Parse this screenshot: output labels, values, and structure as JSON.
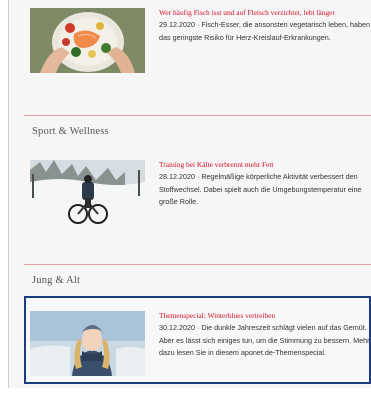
{
  "articles": [
    {
      "title": "Wer häufig Fisch isst und auf Fleisch verzichtet, lebt länger",
      "teaser": "29.12.2020 · Fisch-Esser, die ansonsten vegetarisch leben, haben das geringste Risiko für Herz-Kreislauf-Erkrankungen.",
      "image_icon": "food-plate-photo"
    },
    {
      "title": "Training bei Kälte verbrennt mehr Fett",
      "teaser": "28.12.2020 · Regelmäßige körperliche Aktivität verbessert den Stoffwechsel. Dabei spielt auch die Umgebungstemperatur eine große Rolle.",
      "image_icon": "winter-cyclist-photo"
    },
    {
      "title": "Themenspecial: Winterblues vertreiben",
      "teaser": "30.12.2020 · Die dunkle Jahreszeit schlägt vielen auf das Gemüt. Aber es lässt sich einiges tun, um die Stimmung zu bessern. Mehr dazu lesen Sie in diesem aponet.de-Themenspecial.",
      "image_icon": "winter-woman-photo"
    }
  ],
  "sections": [
    {
      "title": "Sport & Wellness"
    },
    {
      "title": "Jung & Alt"
    }
  ],
  "colors": {
    "title_red": "#d0112b",
    "divider": "#e7a0a6",
    "highlight_border": "#1c3d7d"
  }
}
